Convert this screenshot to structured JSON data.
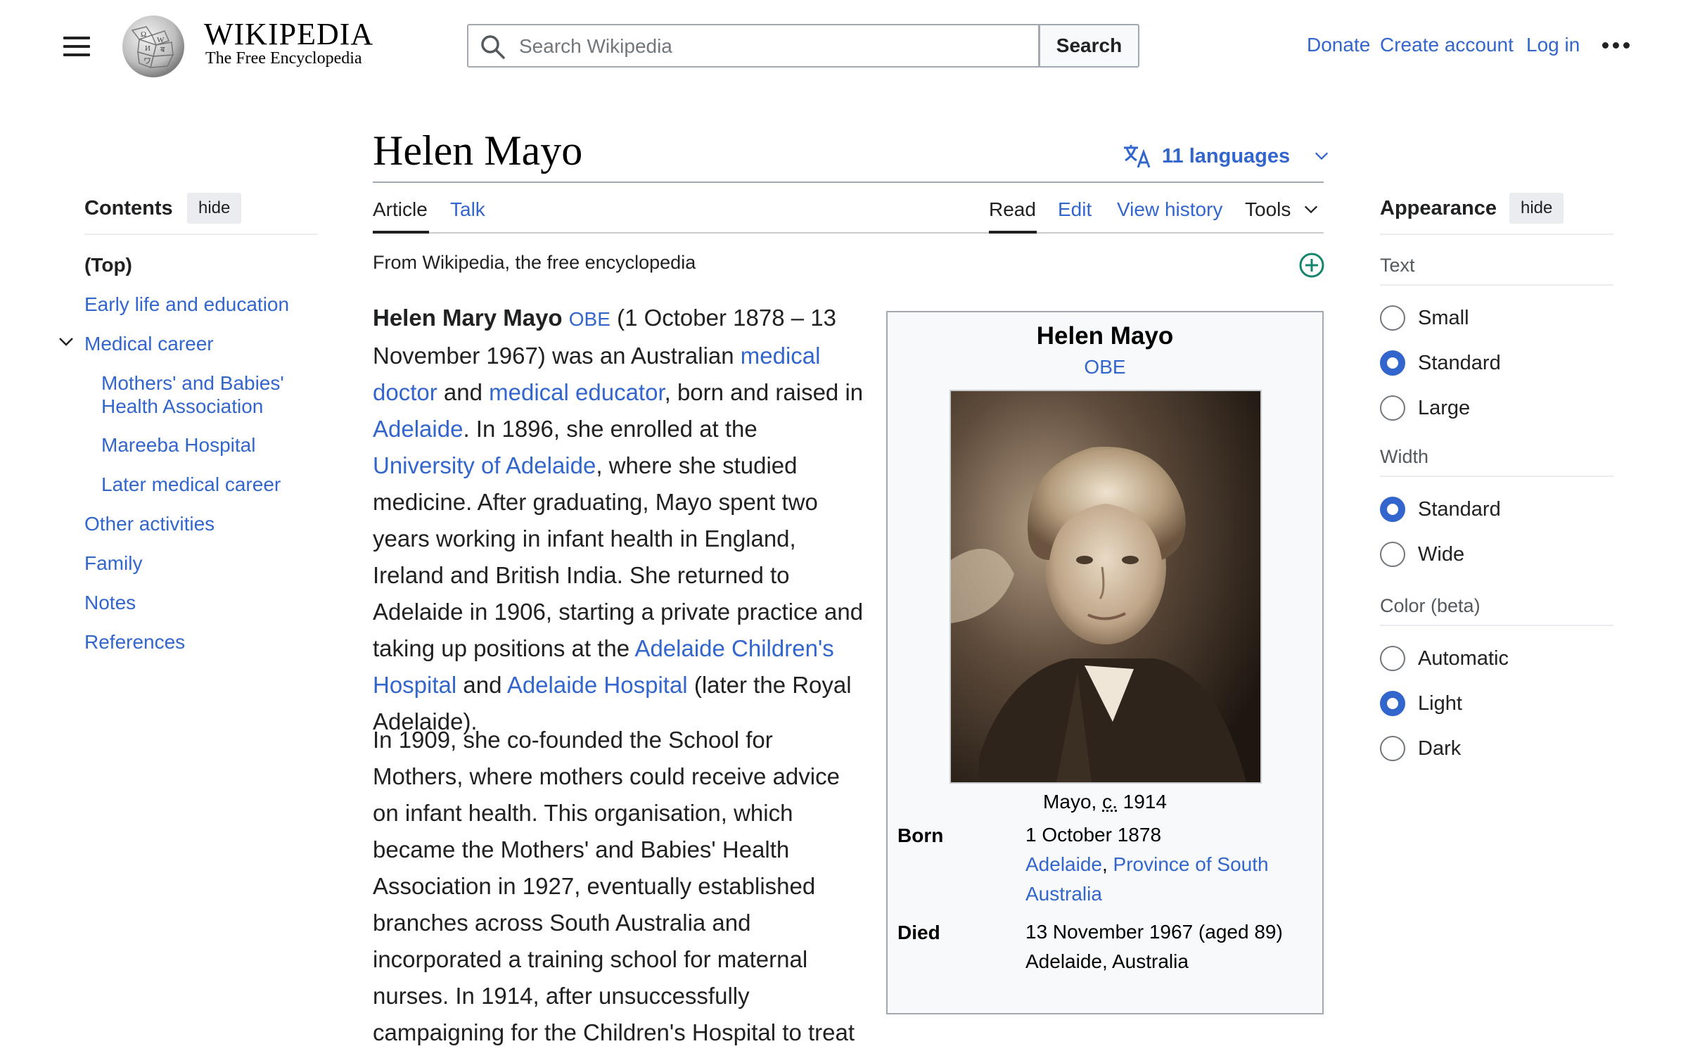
{
  "header": {
    "wordmark": "WIKIPEDIA",
    "tagline": "The Free Encyclopedia",
    "search_placeholder": "Search Wikipedia",
    "search_button": "Search",
    "donate": "Donate",
    "create_account": "Create account",
    "log_in": "Log in",
    "icons": [
      "menu-icon",
      "wikipedia-globe-logo",
      "search-icon",
      "more-options-icon"
    ]
  },
  "article": {
    "title": "Helen Mayo",
    "languages": "11 languages",
    "tabs": {
      "article": "Article",
      "talk": "Talk",
      "read": "Read",
      "edit": "Edit",
      "history": "View history",
      "tools": "Tools"
    },
    "from": "From Wikipedia, the free encyclopedia",
    "para1": {
      "bold": "Helen Mary Mayo",
      "obe": "OBE",
      "t1": " (1 October 1878 – 13 November 1967) was an Australian ",
      "l1": "medical doctor",
      "t2": " and ",
      "l2": "medical educator",
      "t3": ", born and raised in ",
      "l3": "Adelaide",
      "t4": ". In 1896, she enrolled at the ",
      "l4": "University of Adelaide",
      "t5": ", where she studied medicine. After graduating, Mayo spent two years working in infant health in England, Ireland and British India. She returned to Adelaide in 1906, starting a private practice and taking up positions at the ",
      "l5": "Adelaide Children's Hospital",
      "t6": " and ",
      "l6": "Adelaide Hospital",
      "t7": " (later the Royal Adelaide)."
    },
    "para2": "In 1909, she co-founded the School for Mothers, where mothers could receive advice on infant health. This organisation, which became the Mothers' and Babies' Health Association in 1927, eventually established branches across South Australia and incorporated a training school for maternal nurses. In 1914, after unsuccessfully campaigning for the Children's Hospital to treat"
  },
  "infobox": {
    "name": "Helen Mayo",
    "honor": "OBE",
    "caption_pre": "Mayo, ",
    "caption_abbr": "c.",
    "caption_post": " 1914",
    "born_label": "Born",
    "born_date": "1 October 1878",
    "born_place_l1": "Adelaide",
    "born_place_sep": ", ",
    "born_place_l2": "Province of South Australia",
    "died_label": "Died",
    "died_date": "13 November 1967 (aged 89)",
    "died_place": "Adelaide, Australia"
  },
  "toc": {
    "heading": "Contents",
    "hide": "hide",
    "items": [
      {
        "label": "(Top)"
      },
      {
        "label": "Early life and education"
      },
      {
        "label": "Medical career"
      },
      {
        "label": "Mothers' and Babies' Health Association"
      },
      {
        "label": "Mareeba Hospital"
      },
      {
        "label": "Later medical career"
      },
      {
        "label": "Other activities"
      },
      {
        "label": "Family"
      },
      {
        "label": "Notes"
      },
      {
        "label": "References"
      }
    ]
  },
  "appearance": {
    "heading": "Appearance",
    "hide": "hide",
    "text_label": "Text",
    "text_options": [
      "Small",
      "Standard",
      "Large"
    ],
    "text_selected": "Standard",
    "width_label": "Width",
    "width_options": [
      "Standard",
      "Wide"
    ],
    "width_selected": "Standard",
    "color_label": "Color (beta)",
    "color_options": [
      "Automatic",
      "Light",
      "Dark"
    ],
    "color_selected": "Light"
  },
  "colors": {
    "link": "#3366cc",
    "text": "#202122",
    "border": "#a2a9b1",
    "infobox_bg": "#f8f9fa",
    "add_icon": "#14866d"
  }
}
